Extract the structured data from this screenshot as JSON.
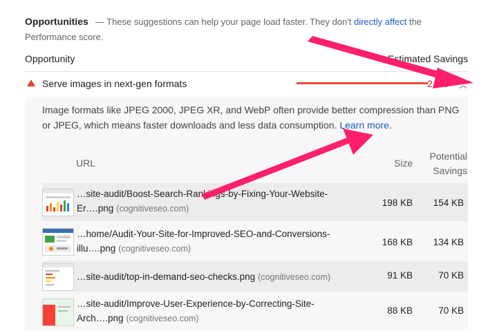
{
  "header": {
    "title": "Opportunities",
    "desc_pre": "— These suggestions can help your page load faster. They don't ",
    "desc_link": "directly affect",
    "desc_post": " the Performance score."
  },
  "columns": {
    "opportunity": "Opportunity",
    "estimated_savings": "Estimated Savings"
  },
  "audit": {
    "title": "Serve images in next-gen formats",
    "savings": "2.5 s",
    "savings_fraction": 0.95,
    "description": "Image formats like JPEG 2000, JPEG XR, and WebP often provide better compression than PNG or JPEG, which means faster downloads and less data consumption. ",
    "learn_more": "Learn more",
    "period": "."
  },
  "table": {
    "headers": {
      "url": "URL",
      "size": "Size",
      "potential_1": "Potential",
      "potential_2": "Savings"
    },
    "rows": [
      {
        "url_1": "…site-audit/Boost-Search-Rankings-by-Fixing-Your-Website-",
        "url_2": "Er….png",
        "host": "(cognitiveseo.com)",
        "size": "198 KB",
        "savings": "154 KB"
      },
      {
        "url_1": "…home/Audit-Your-Site-for-Improved-SEO-and-Conversions-",
        "url_2": "illu….png",
        "host": "(cognitiveseo.com)",
        "size": "168 KB",
        "savings": "134 KB"
      },
      {
        "url_1": "…site-audit/top-in-demand-seo-checks.png",
        "url_2": "",
        "host": "(cognitiveseo.com)",
        "size": "91 KB",
        "savings": "70 KB"
      },
      {
        "url_1": "…site-audit/Improve-User-Experience-by-Correcting-Site-",
        "url_2": "Arch….png",
        "host": "(cognitiveseo.com)",
        "size": "88 KB",
        "savings": "70 KB"
      }
    ]
  },
  "colors": {
    "fail": "#eb3d2c",
    "link": "#1a56c4",
    "annotation_arrow": "#ff1f6b"
  }
}
